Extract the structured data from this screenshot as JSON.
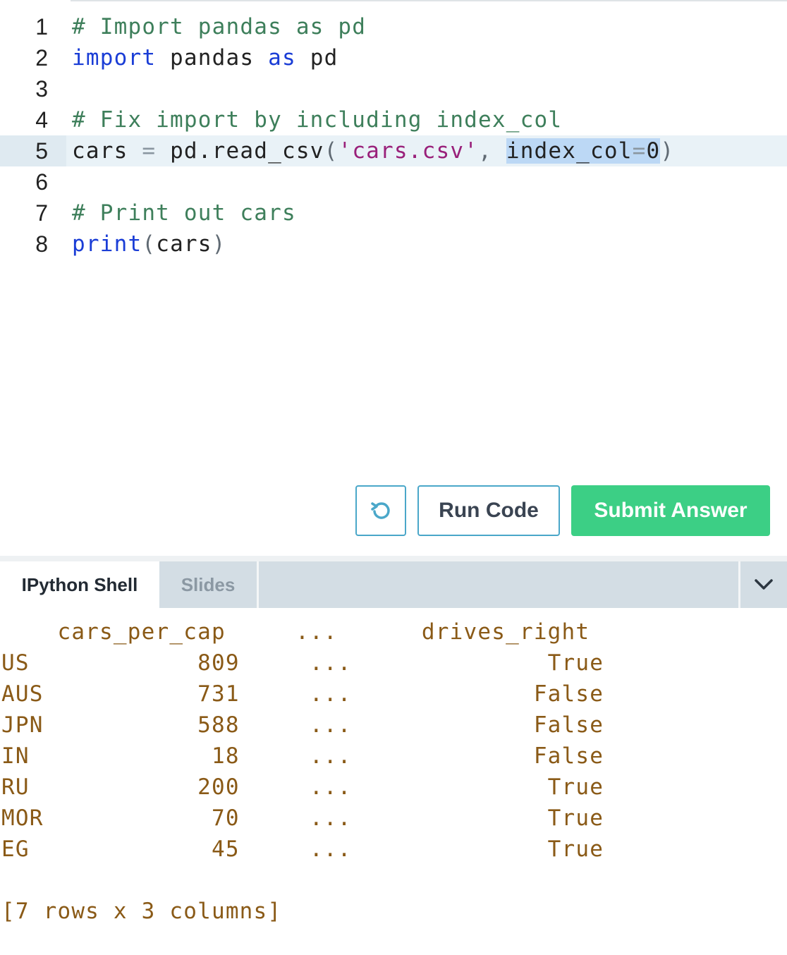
{
  "editor": {
    "lines": [
      {
        "n": "1",
        "parts": [
          {
            "t": "# Import pandas as pd",
            "c": "cm"
          }
        ]
      },
      {
        "n": "2",
        "parts": [
          {
            "t": "import",
            "c": "kw"
          },
          {
            "t": " pandas ",
            "c": ""
          },
          {
            "t": "as",
            "c": "kw"
          },
          {
            "t": " pd",
            "c": ""
          }
        ]
      },
      {
        "n": "3",
        "parts": []
      },
      {
        "n": "4",
        "parts": [
          {
            "t": "# Fix import by including index_col",
            "c": "cm"
          }
        ]
      },
      {
        "n": "5",
        "active": true,
        "parts": [
          {
            "t": "cars ",
            "c": ""
          },
          {
            "t": "=",
            "c": "op"
          },
          {
            "t": " pd.read_csv",
            "c": ""
          },
          {
            "t": "(",
            "c": "pn"
          },
          {
            "t": "'cars.csv'",
            "c": "str"
          },
          {
            "t": ", ",
            "c": "pn"
          },
          {
            "t": "index_col",
            "c": "sel"
          },
          {
            "t": "=",
            "c": "sel op"
          },
          {
            "t": "0",
            "c": "sel"
          },
          {
            "t": ")",
            "c": "pn"
          }
        ]
      },
      {
        "n": "6",
        "parts": []
      },
      {
        "n": "7",
        "parts": [
          {
            "t": "# Print out cars",
            "c": "cm"
          }
        ]
      },
      {
        "n": "8",
        "parts": [
          {
            "t": "print",
            "c": "kw"
          },
          {
            "t": "(",
            "c": "pn"
          },
          {
            "t": "cars",
            "c": ""
          },
          {
            "t": ")",
            "c": "pn"
          }
        ]
      }
    ]
  },
  "actions": {
    "reset_icon": "reset-icon",
    "run_label": "Run Code",
    "submit_label": "Submit Answer",
    "accent": "#4aa7c9",
    "submit_color": "#3ccf85"
  },
  "tabs": [
    {
      "label": "IPython Shell",
      "active": true
    },
    {
      "label": "Slides",
      "active": false
    }
  ],
  "collapse_icon": "chevron-down-icon",
  "shell": {
    "output_lines": [
      "    cars_per_cap     ...      drives_right",
      "US            809     ...              True",
      "AUS           731     ...             False",
      "JPN           588     ...             False",
      "IN             18     ...             False",
      "RU            200     ...              True",
      "MOR            70     ...              True",
      "EG             45     ...              True",
      "",
      "[7 rows x 3 columns]"
    ]
  }
}
